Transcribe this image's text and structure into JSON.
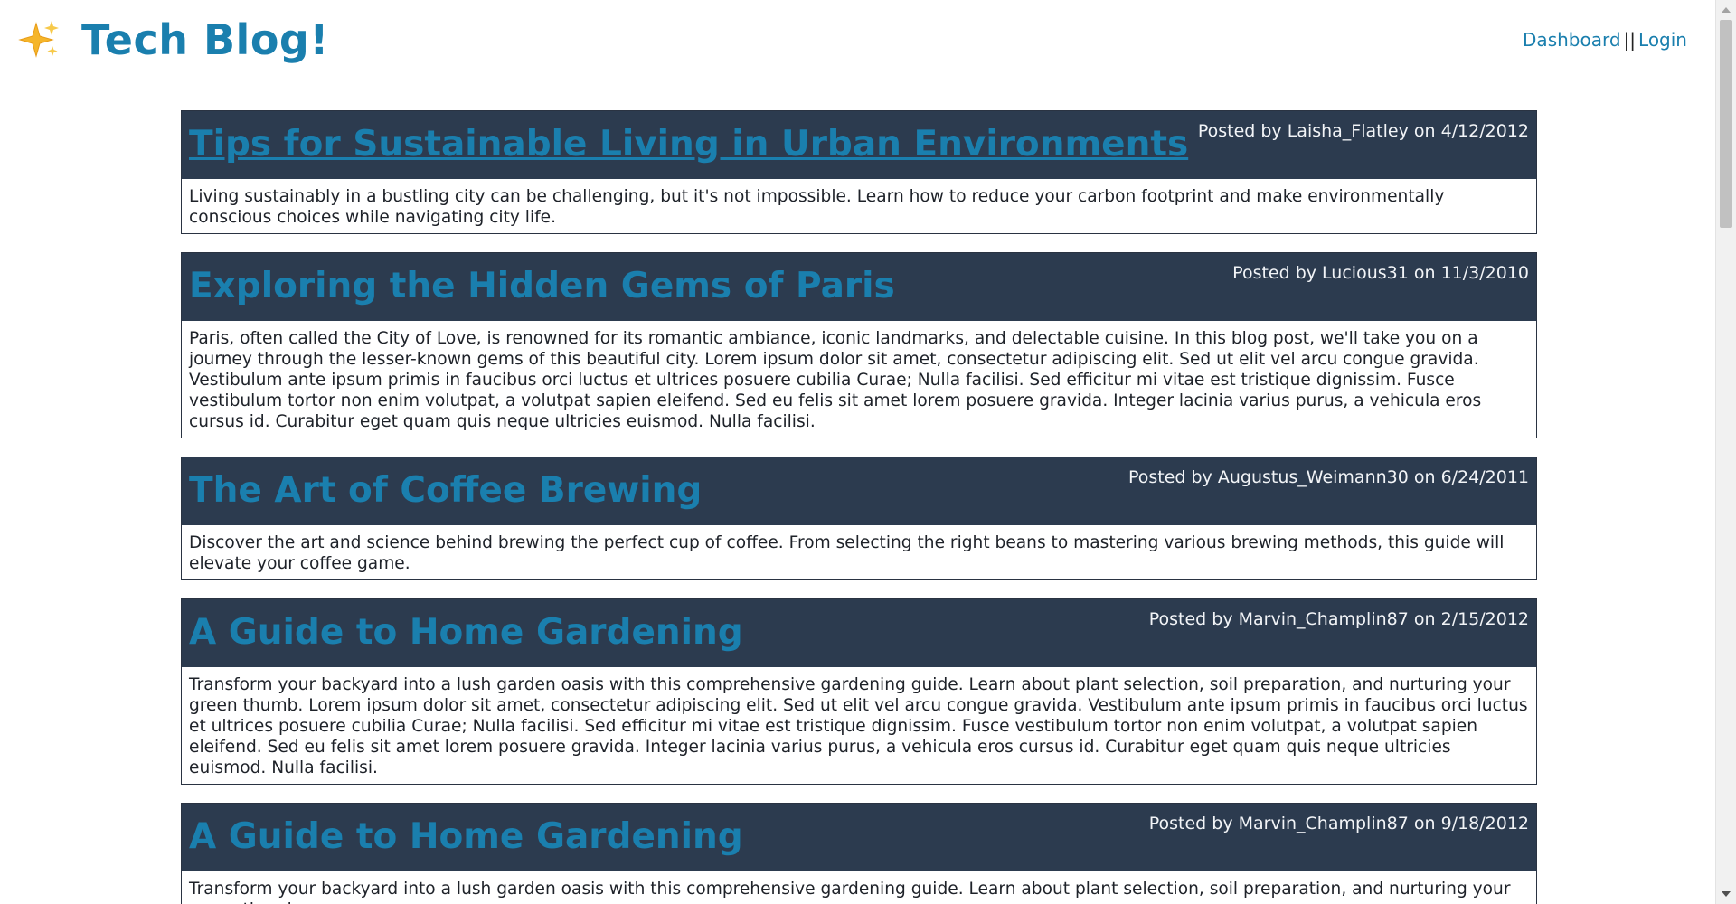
{
  "header": {
    "brand_icon": "sparkles-icon",
    "title": "Tech Blog!",
    "nav": {
      "dashboard": "Dashboard",
      "separator": "||",
      "login": "Login"
    }
  },
  "posts": [
    {
      "title": "Tips for Sustainable Living in Urban Environments",
      "meta": "Posted by Laisha_Flatley on 4/12/2012",
      "body": "Living sustainably in a bustling city can be challenging, but it's not impossible. Learn how to reduce your carbon footprint and make environmentally conscious choices while navigating city life."
    },
    {
      "title": "Exploring the Hidden Gems of Paris",
      "meta": "Posted by Lucious31 on 11/3/2010",
      "body": "Paris, often called the City of Love, is renowned for its romantic ambiance, iconic landmarks, and delectable cuisine. In this blog post, we'll take you on a journey through the lesser-known gems of this beautiful city. Lorem ipsum dolor sit amet, consectetur adipiscing elit. Sed ut elit vel arcu congue gravida. Vestibulum ante ipsum primis in faucibus orci luctus et ultrices posuere cubilia Curae; Nulla facilisi. Sed efficitur mi vitae est tristique dignissim. Fusce vestibulum tortor non enim volutpat, a volutpat sapien eleifend. Sed eu felis sit amet lorem posuere gravida. Integer lacinia varius purus, a vehicula eros cursus id. Curabitur eget quam quis neque ultricies euismod. Nulla facilisi."
    },
    {
      "title": "The Art of Coffee Brewing",
      "meta": "Posted by Augustus_Weimann30 on 6/24/2011",
      "body": "Discover the art and science behind brewing the perfect cup of coffee. From selecting the right beans to mastering various brewing methods, this guide will elevate your coffee game."
    },
    {
      "title": "A Guide to Home Gardening",
      "meta": "Posted by Marvin_Champlin87 on 2/15/2012",
      "body": "Transform your backyard into a lush garden oasis with this comprehensive gardening guide. Learn about plant selection, soil preparation, and nurturing your green thumb. Lorem ipsum dolor sit amet, consectetur adipiscing elit. Sed ut elit vel arcu congue gravida. Vestibulum ante ipsum primis in faucibus orci luctus et ultrices posuere cubilia Curae; Nulla facilisi. Sed efficitur mi vitae est tristique dignissim. Fusce vestibulum tortor non enim volutpat, a volutpat sapien eleifend. Sed eu felis sit amet lorem posuere gravida. Integer lacinia varius purus, a vehicula eros cursus id. Curabitur eget quam quis neque ultricies euismod. Nulla facilisi."
    },
    {
      "title": "A Guide to Home Gardening",
      "meta": "Posted by Marvin_Champlin87 on 9/18/2012",
      "body": "Transform your backyard into a lush garden oasis with this comprehensive gardening guide. Learn about plant selection, soil preparation, and nurturing your green thumb."
    }
  ],
  "colors": {
    "accent": "#1a7fae",
    "post_header_bg": "#2c3b4f",
    "meta_text": "#f2f4f7"
  }
}
